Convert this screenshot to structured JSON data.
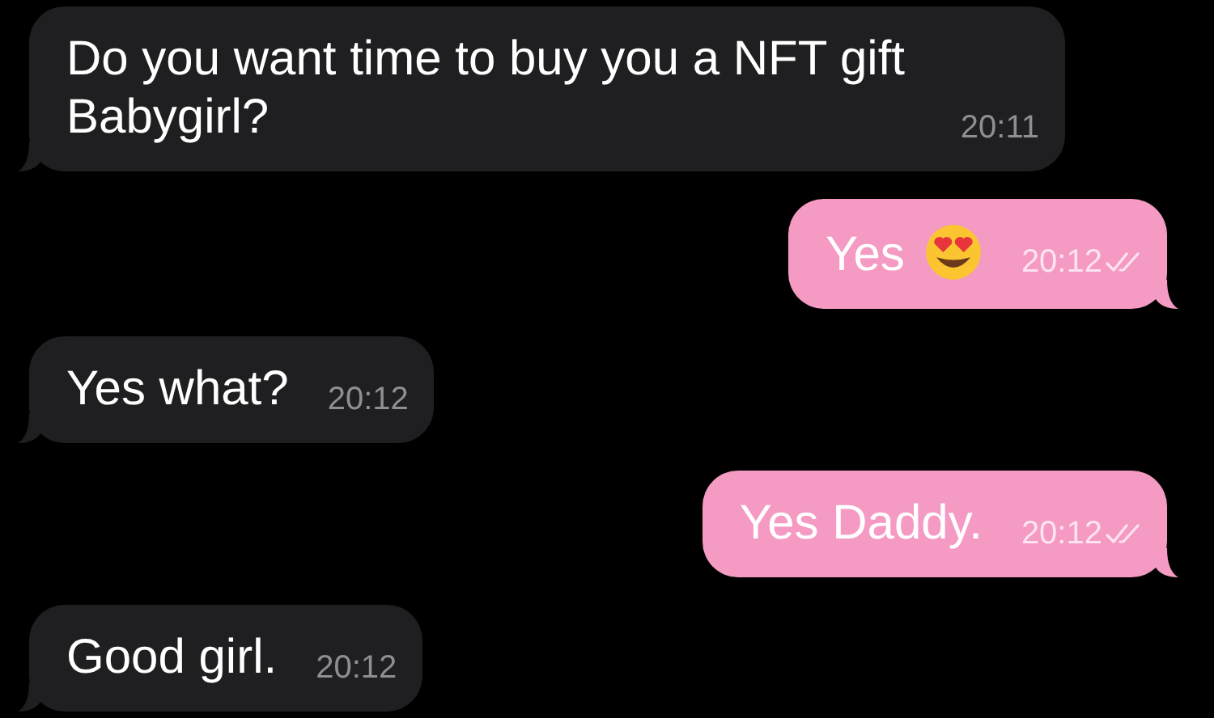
{
  "messages": [
    {
      "outgoing": false,
      "parts": [
        {
          "kind": "text",
          "text": "Do you want time to buy you a NFT gift Babygirl?"
        }
      ],
      "time": "20:11",
      "read": false
    },
    {
      "outgoing": true,
      "parts": [
        {
          "kind": "text",
          "text": "Yes"
        },
        {
          "kind": "emoji"
        }
      ],
      "time": "20:12",
      "read": true
    },
    {
      "outgoing": false,
      "parts": [
        {
          "kind": "text",
          "text": "Yes what?"
        }
      ],
      "time": "20:12",
      "read": false
    },
    {
      "outgoing": true,
      "parts": [
        {
          "kind": "text",
          "text": "Yes Daddy."
        }
      ],
      "time": "20:12",
      "read": true
    },
    {
      "outgoing": false,
      "parts": [
        {
          "kind": "text",
          "text": "Good girl."
        }
      ],
      "time": "20:12",
      "read": false
    }
  ]
}
